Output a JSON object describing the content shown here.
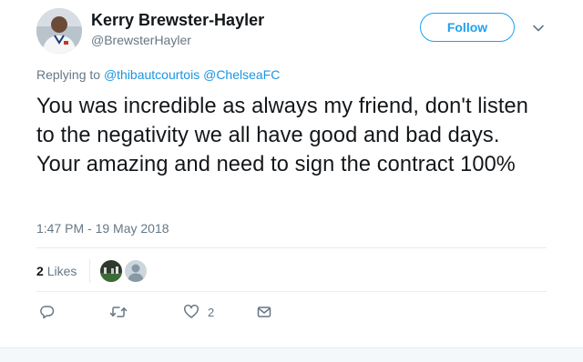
{
  "author": {
    "name": "Kerry Brewster-Hayler",
    "handle": "@BrewsterHayler"
  },
  "follow_label": "Follow",
  "reply": {
    "prefix": "Replying to",
    "mentions": [
      "@thibautcourtois",
      "@ChelseaFC"
    ]
  },
  "tweet": {
    "text": "You was incredible as always my friend, don't listen to the negativity we all have good and bad days. Your amazing and need to sign the contract 100%",
    "timestamp": "1:47 PM - 19 May 2018"
  },
  "stats": {
    "likes_count": "2",
    "likes_label": "Likes"
  },
  "actions": {
    "like_count": "2"
  },
  "colors": {
    "accent": "#1da1f2",
    "link": "#1b95e0",
    "muted": "#657786",
    "text": "#14171a"
  },
  "icons": [
    "caret-down-icon",
    "reply-icon",
    "retweet-icon",
    "heart-icon",
    "direct-message-icon"
  ]
}
